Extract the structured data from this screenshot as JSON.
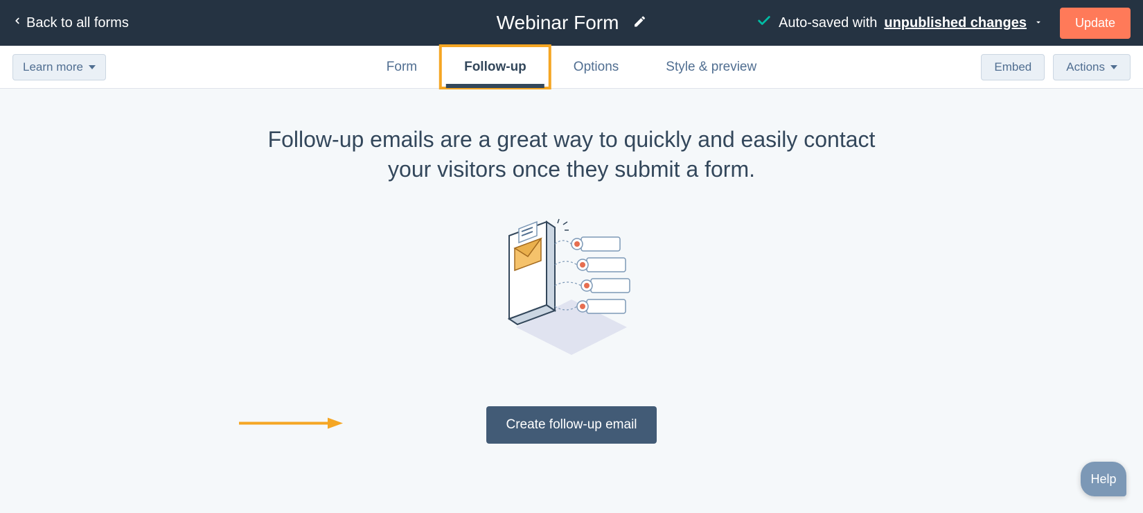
{
  "header": {
    "back_label": "Back to all forms",
    "title": "Webinar Form",
    "autosave_prefix": "Auto-saved with ",
    "autosave_highlight": "unpublished changes",
    "update_label": "Update"
  },
  "subnav": {
    "learn_more_label": "Learn more",
    "tabs": [
      {
        "label": "Form",
        "active": false
      },
      {
        "label": "Follow-up",
        "active": true,
        "highlighted": true
      },
      {
        "label": "Options",
        "active": false
      },
      {
        "label": "Style & preview",
        "active": false
      }
    ],
    "embed_label": "Embed",
    "actions_label": "Actions"
  },
  "main": {
    "headline": "Follow-up emails are a great way to quickly and easily contact your visitors once they submit a form.",
    "cta_label": "Create follow-up email"
  },
  "help": {
    "label": "Help"
  }
}
